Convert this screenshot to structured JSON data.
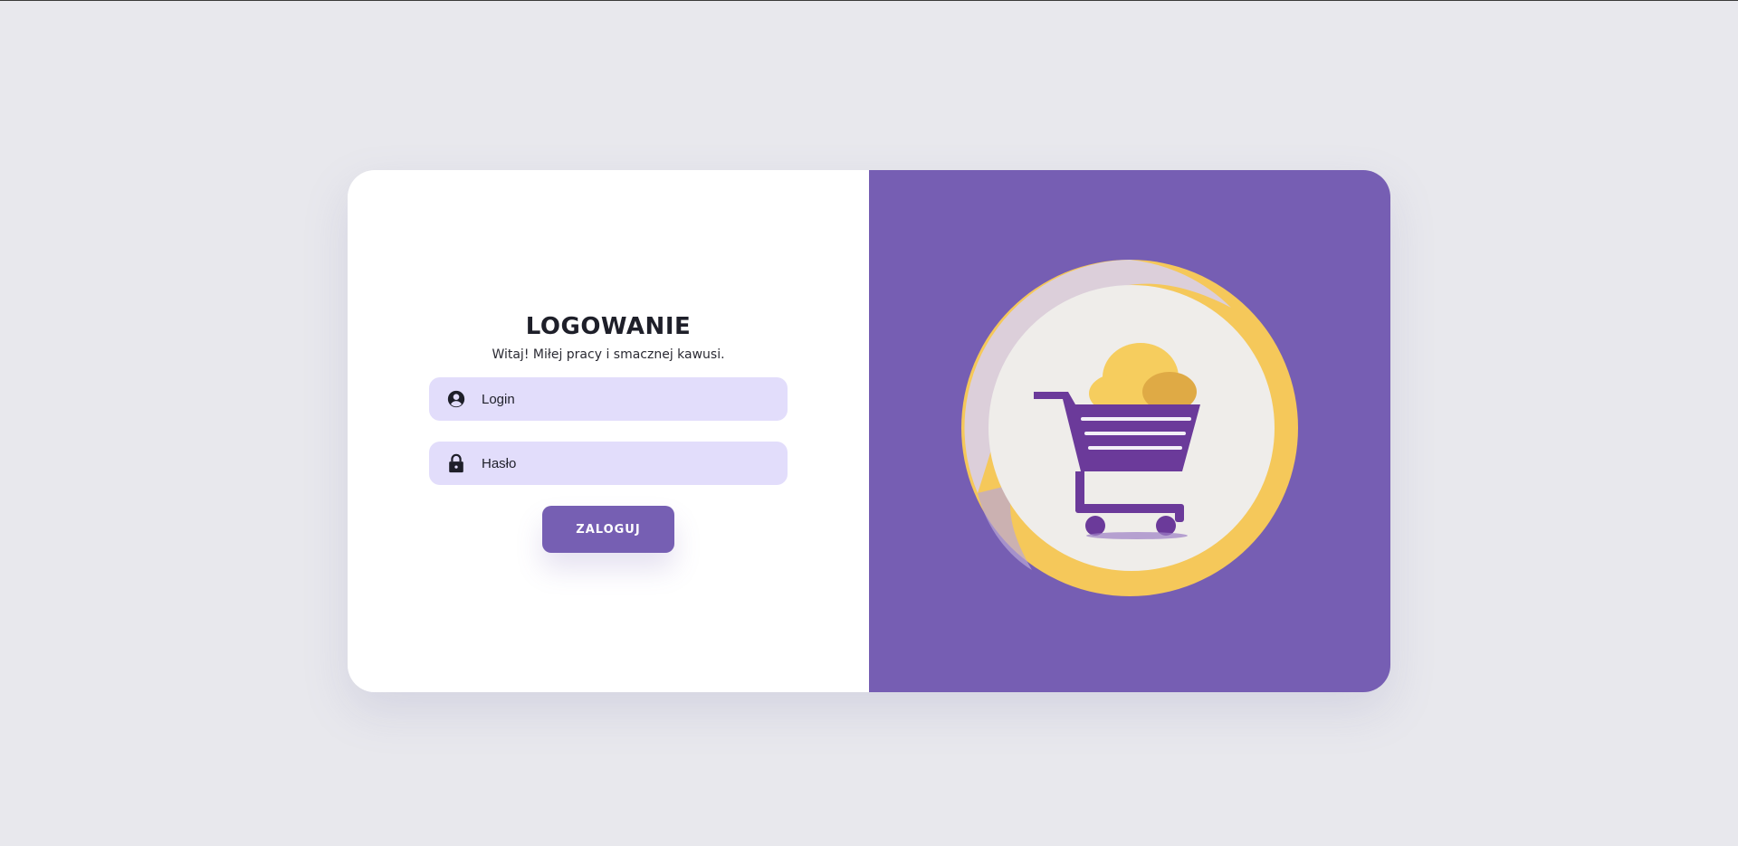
{
  "login_form": {
    "title": "LOGOWANIE",
    "subtitle": "Witaj! Miłej pracy i smacznej kawusi.",
    "login_placeholder": "Login",
    "login_value": "",
    "password_placeholder": "Hasło",
    "password_value": "",
    "submit_label": "ZALOGUJ"
  },
  "icons": {
    "login_field": "user-circle-icon",
    "password_field": "lock-icon",
    "illustration": "shopping-cart-logo"
  },
  "colors": {
    "page_background": "#e8e8ed",
    "accent": "#765fb3",
    "input_background": "#e2ddfb",
    "panel_right": "#765eb3",
    "logo_gold": "#f5c85a",
    "heading": "#1e1f29"
  }
}
